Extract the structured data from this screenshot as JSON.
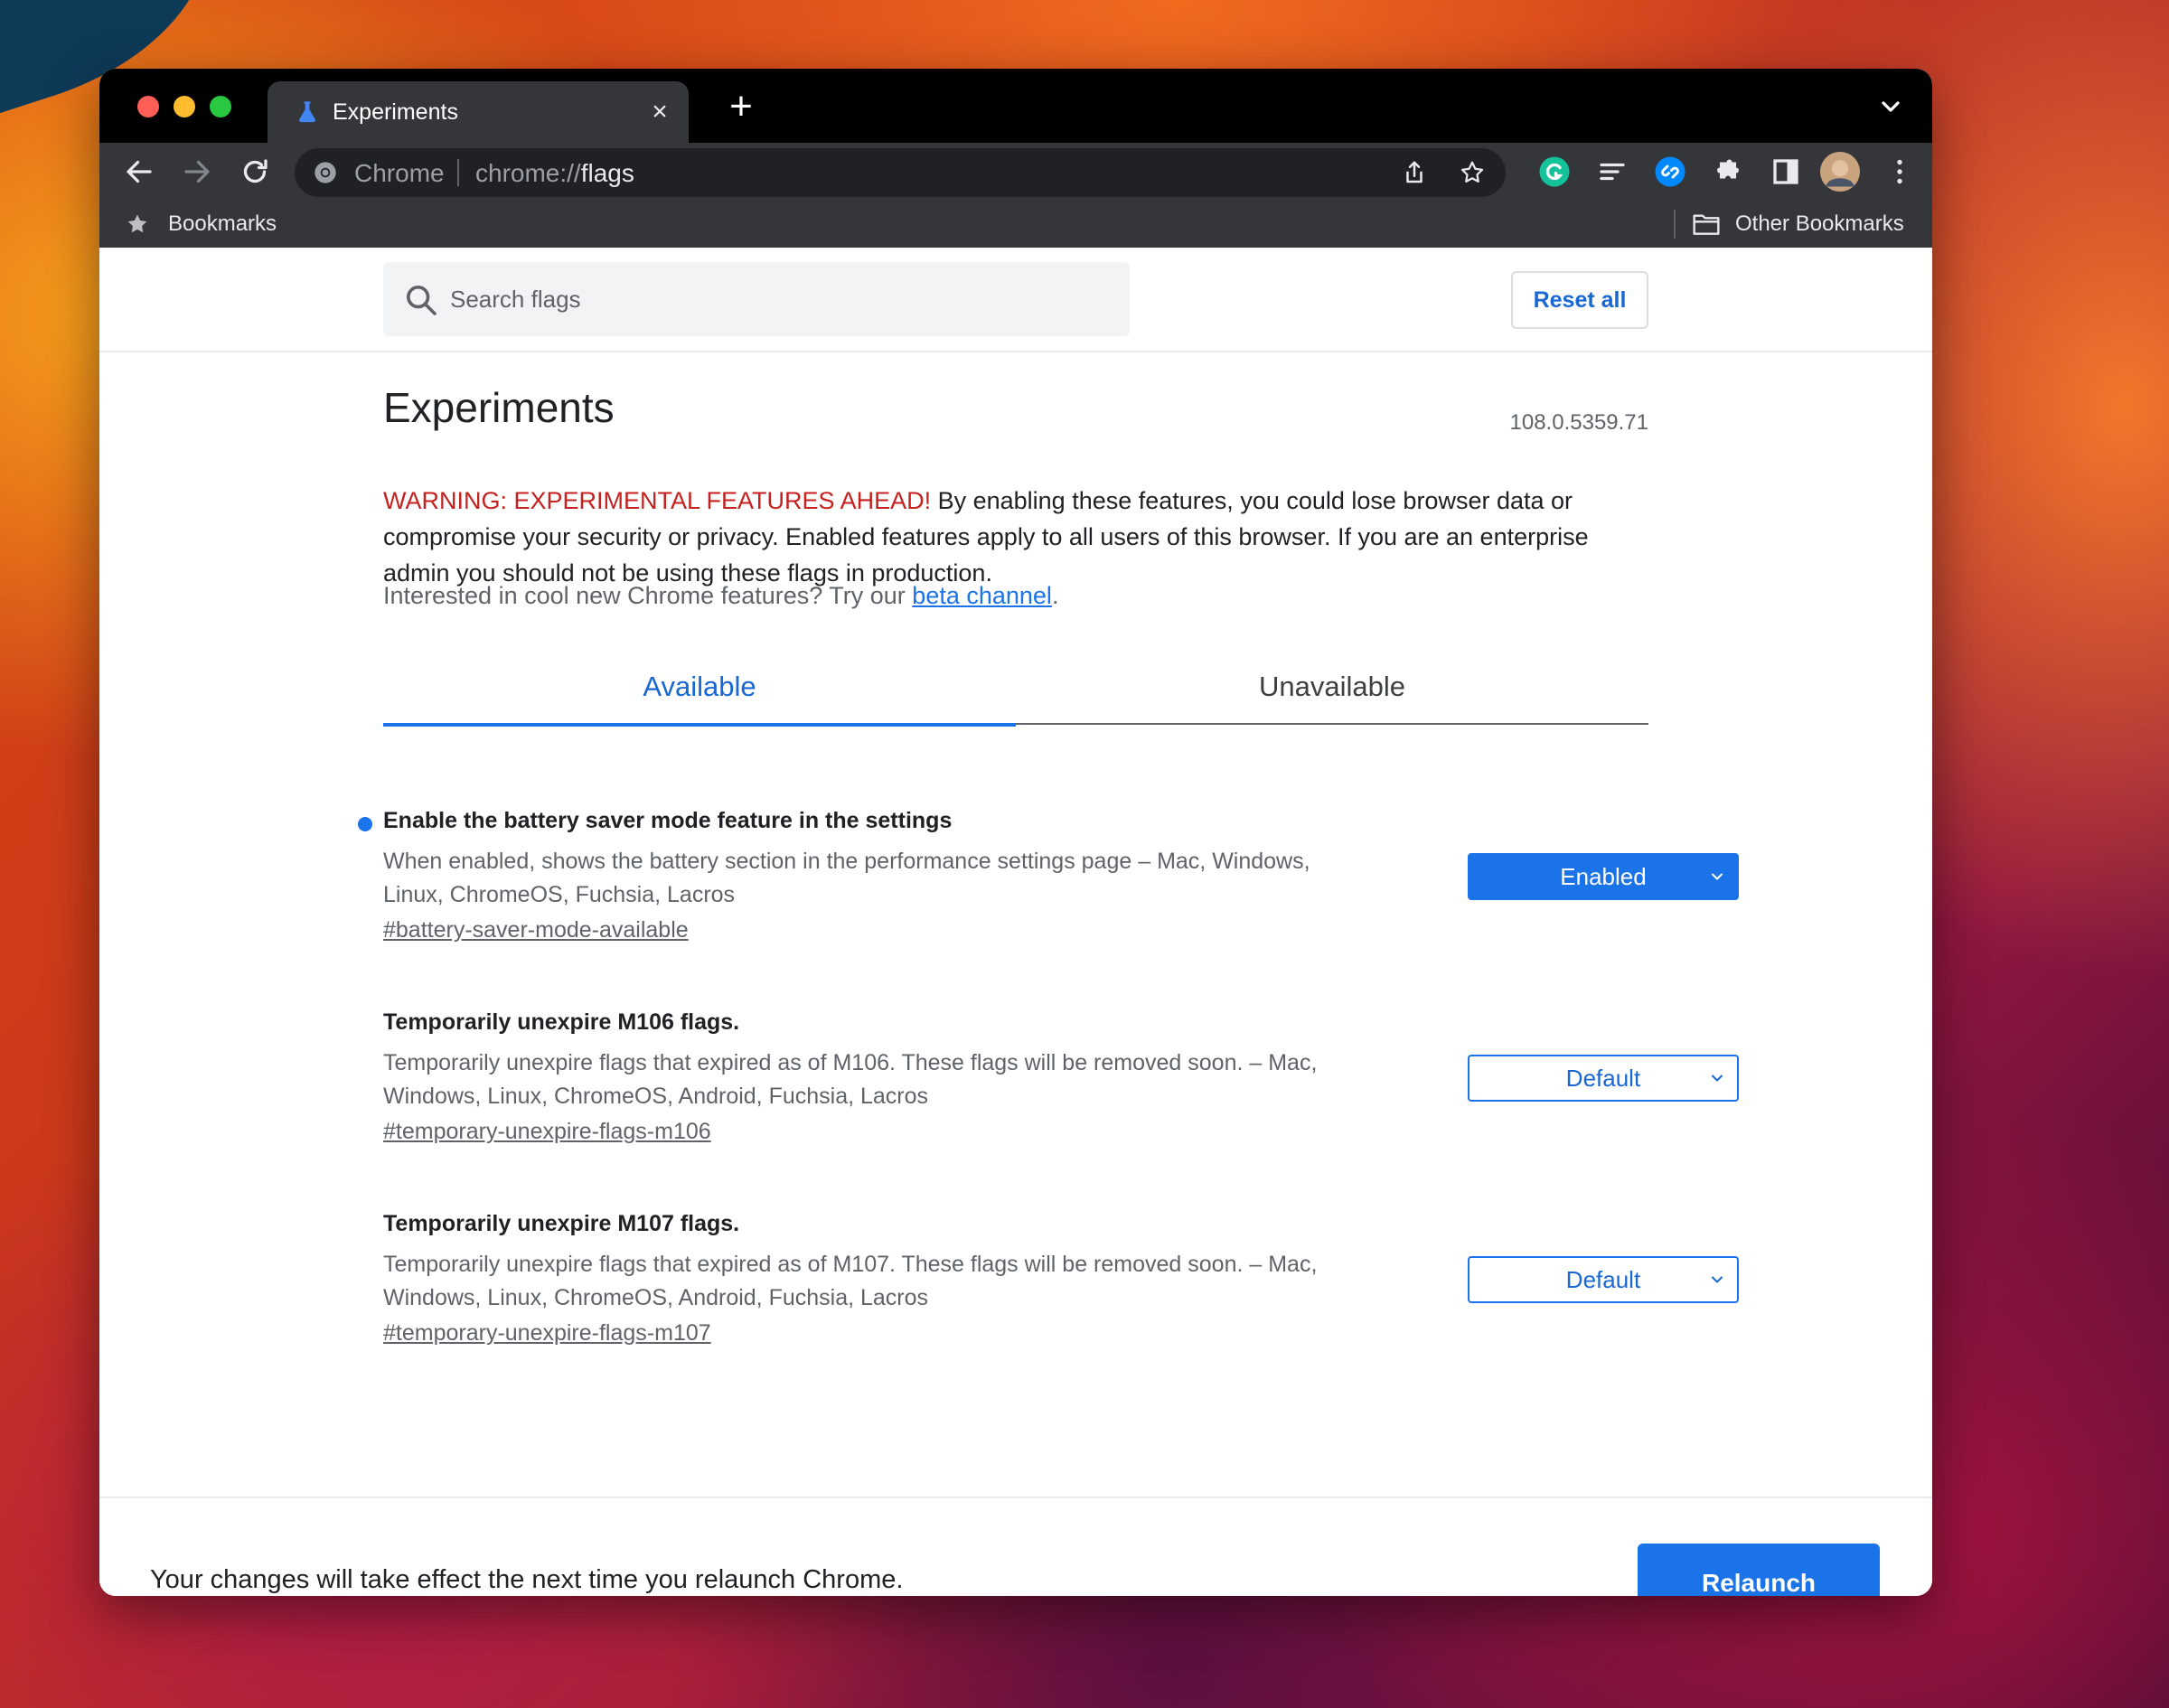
{
  "browser": {
    "tab_title": "Experiments",
    "omnibox_origin": "Chrome",
    "omnibox_url_scheme": "chrome://",
    "omnibox_url_path": "flags",
    "bookmarks_label": "Bookmarks",
    "other_bookmarks_label": "Other Bookmarks"
  },
  "page": {
    "search_placeholder": "Search flags",
    "reset_label": "Reset all",
    "title": "Experiments",
    "version": "108.0.5359.71",
    "warning_red": "WARNING: EXPERIMENTAL FEATURES AHEAD!",
    "warning_text": " By enabling these features, you could lose browser data or compromise your security or privacy. Enabled features apply to all users of this browser. If you are an enterprise admin you should not be using these flags in production.",
    "promo_text": "Interested in cool new Chrome features? Try our ",
    "promo_link": "beta channel",
    "promo_end": ".",
    "tabs": [
      {
        "label": "Available",
        "active": true
      },
      {
        "label": "Unavailable",
        "active": false
      }
    ],
    "flags": [
      {
        "title": "Enable the battery saver mode feature in the settings",
        "description": "When enabled, shows the battery section in the performance settings page – Mac, Windows, Linux, ChromeOS, Fuchsia, Lacros",
        "link": "#battery-saver-mode-available",
        "value": "Enabled"
      },
      {
        "title": "Temporarily unexpire M106 flags.",
        "description": "Temporarily unexpire flags that expired as of M106. These flags will be removed soon. – Mac, Windows, Linux, ChromeOS, Android, Fuchsia, Lacros",
        "link": "#temporary-unexpire-flags-m106",
        "value": "Default"
      },
      {
        "title": "Temporarily unexpire M107 flags.",
        "description": "Temporarily unexpire flags that expired as of M107. These flags will be removed soon. – Mac, Windows, Linux, ChromeOS, Android, Fuchsia, Lacros",
        "link": "#temporary-unexpire-flags-m107",
        "value": "Default"
      }
    ],
    "footer_text": "Your changes will take effect the next time you relaunch Chrome.",
    "relaunch_label": "Relaunch"
  },
  "colors": {
    "accent": "#1a73e8",
    "warning": "#c5221f",
    "toolbar": "#35363a"
  }
}
